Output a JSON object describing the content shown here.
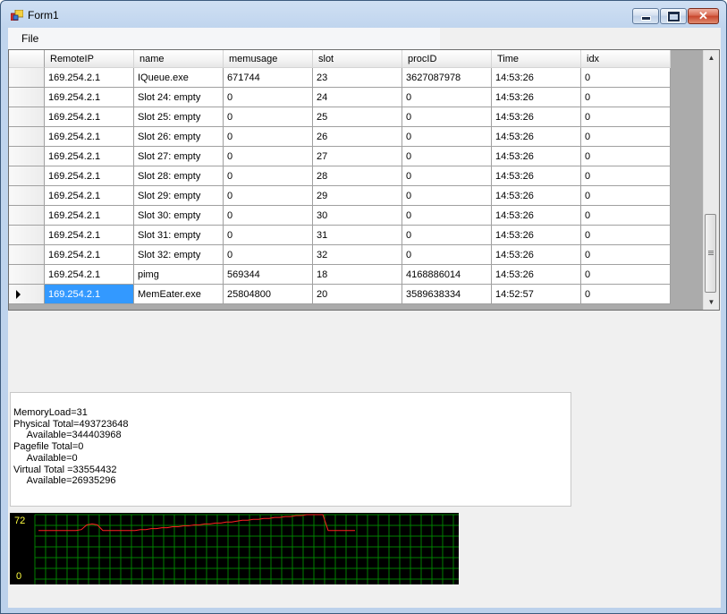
{
  "window": {
    "title": "Form1"
  },
  "menu": {
    "file": "File"
  },
  "grid": {
    "columns": [
      "RemoteIP",
      "name",
      "memusage",
      "slot",
      "procID",
      "Time",
      "idx"
    ],
    "rows": [
      [
        "169.254.2.1",
        "IQueue.exe",
        "671744",
        "23",
        "3627087978",
        "14:53:26",
        "0"
      ],
      [
        "169.254.2.1",
        "Slot 24: empty",
        "0",
        "24",
        "0",
        "14:53:26",
        "0"
      ],
      [
        "169.254.2.1",
        "Slot 25: empty",
        "0",
        "25",
        "0",
        "14:53:26",
        "0"
      ],
      [
        "169.254.2.1",
        "Slot 26: empty",
        "0",
        "26",
        "0",
        "14:53:26",
        "0"
      ],
      [
        "169.254.2.1",
        "Slot 27: empty",
        "0",
        "27",
        "0",
        "14:53:26",
        "0"
      ],
      [
        "169.254.2.1",
        "Slot 28: empty",
        "0",
        "28",
        "0",
        "14:53:26",
        "0"
      ],
      [
        "169.254.2.1",
        "Slot 29: empty",
        "0",
        "29",
        "0",
        "14:53:26",
        "0"
      ],
      [
        "169.254.2.1",
        "Slot 30: empty",
        "0",
        "30",
        "0",
        "14:53:26",
        "0"
      ],
      [
        "169.254.2.1",
        "Slot 31: empty",
        "0",
        "31",
        "0",
        "14:53:26",
        "0"
      ],
      [
        "169.254.2.1",
        "Slot 32: empty",
        "0",
        "32",
        "0",
        "14:53:26",
        "0"
      ],
      [
        "169.254.2.1",
        "pimg",
        "569344",
        "18",
        "4168886014",
        "14:53:26",
        "0"
      ],
      [
        "169.254.2.1",
        "MemEater.exe",
        "25804800",
        "20",
        "3589638334",
        "14:52:57",
        "0"
      ]
    ],
    "selected_row": 11
  },
  "memory_info": {
    "lines": [
      "MemoryLoad=31",
      "Physical Total=493723648",
      "     Available=344403968",
      "Pagefile Total=0",
      "     Available=0",
      "Virtual Total =33554432",
      "     Available=26935296"
    ]
  },
  "chart_data": {
    "type": "line",
    "ylim": [
      0,
      72
    ],
    "y_tick_labels": [
      "72",
      "0"
    ],
    "grid": true,
    "colors": {
      "background": "#000000",
      "grid": "#008000",
      "line": "#ff2020",
      "labels": "#ffff40"
    },
    "series": [
      {
        "values": [
          55,
          55,
          55,
          55,
          55,
          55,
          55,
          55,
          56,
          61,
          62,
          61,
          55,
          55,
          55,
          55,
          55,
          55,
          55,
          56,
          56,
          57,
          57,
          58,
          58,
          59,
          59,
          60,
          60,
          61,
          61,
          62,
          62,
          63,
          63,
          64,
          64,
          65,
          66,
          66,
          67,
          67,
          68,
          68,
          69,
          69,
          70,
          70,
          71,
          71,
          72,
          72,
          72,
          72,
          55,
          55,
          55,
          55,
          55,
          55
        ]
      }
    ]
  }
}
